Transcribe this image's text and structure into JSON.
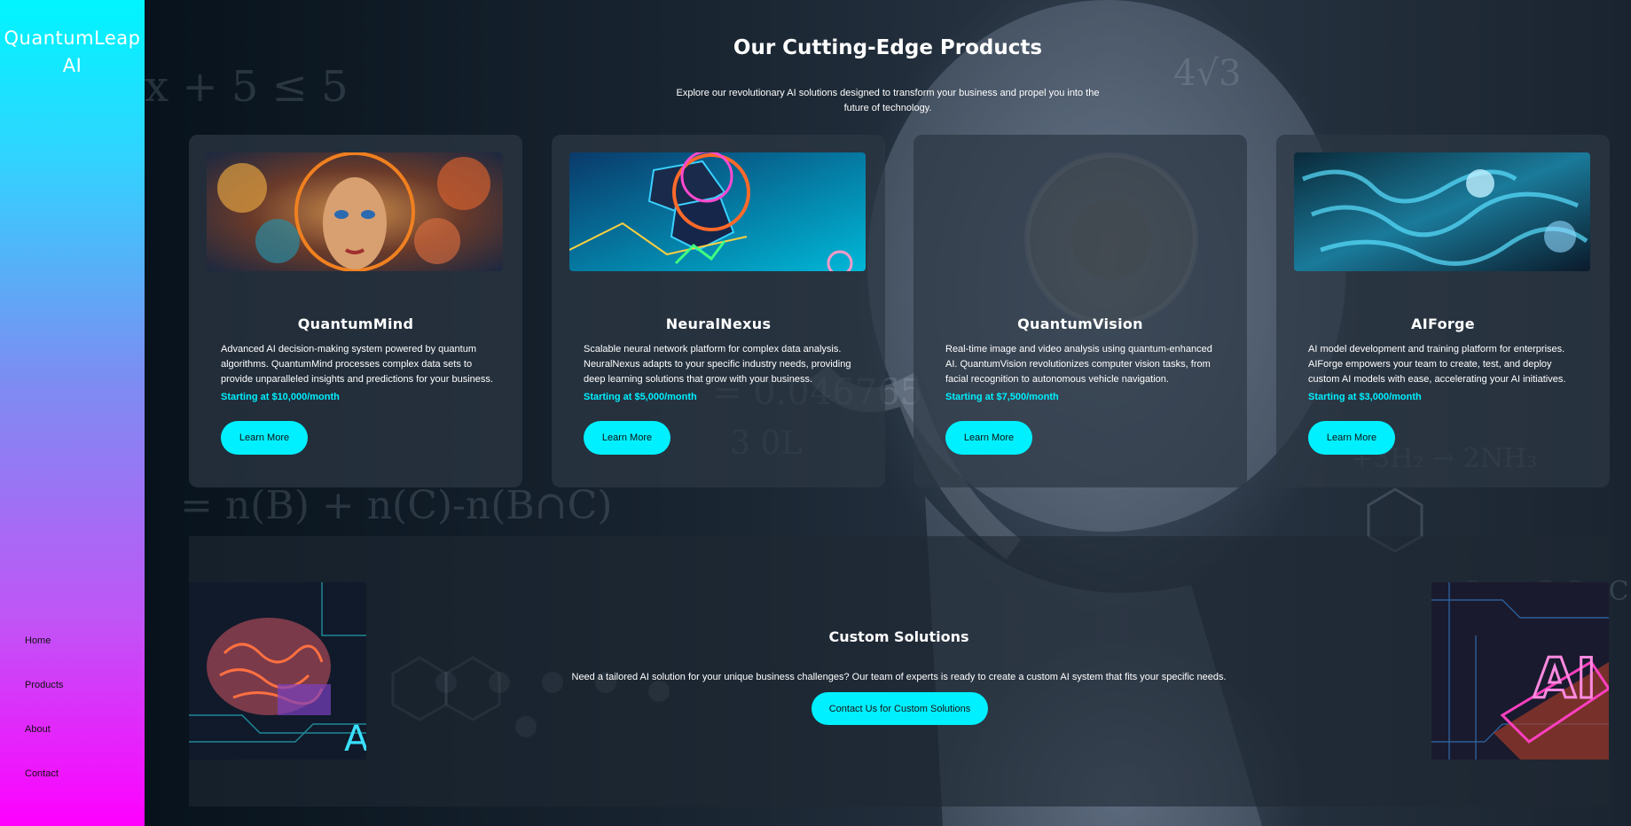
{
  "sidebar": {
    "logo": "QuantumLeap AI",
    "nav": [
      "Home",
      "Products",
      "About",
      "Contact"
    ]
  },
  "products_section": {
    "title": "Our Cutting-Edge Products",
    "subtitle": "Explore our revolutionary AI solutions designed to transform your business and propel you into the future of technology."
  },
  "products": [
    {
      "name": "QuantumMind",
      "description": "Advanced AI decision-making system powered by quantum algorithms. QuantumMind processes complex data sets to provide unparalleled insights and predictions for your business.",
      "price": "Starting at $10,000/month",
      "button": "Learn More"
    },
    {
      "name": "NeuralNexus",
      "description": "Scalable neural network platform for complex data analysis. NeuralNexus adapts to your specific industry needs, providing deep learning solutions that grow with your business.",
      "price": "Starting at $5,000/month",
      "button": "Learn More"
    },
    {
      "name": "QuantumVision",
      "description": "Real-time image and video analysis using quantum-enhanced AI. QuantumVision revolutionizes computer vision tasks, from facial recognition to autonomous vehicle navigation.",
      "price": "Starting at $7,500/month",
      "button": "Learn More"
    },
    {
      "name": "AIForge",
      "description": "AI model development and training platform for enterprises. AIForge empowers your team to create, test, and deploy custom AI models with ease, accelerating your AI initiatives.",
      "price": "Starting at $3,000/month",
      "button": "Learn More"
    }
  ],
  "custom": {
    "title": "Custom Solutions",
    "description": "Need a tailored AI solution for your unique business challenges? Our team of experts is ready to create a custom AI system that fits your specific needs.",
    "button": "Contact Us for Custom Solutions"
  },
  "colors": {
    "accent": "#00f0ff",
    "sidebar_top": "#00f5ff",
    "sidebar_bottom": "#ff00ff"
  }
}
